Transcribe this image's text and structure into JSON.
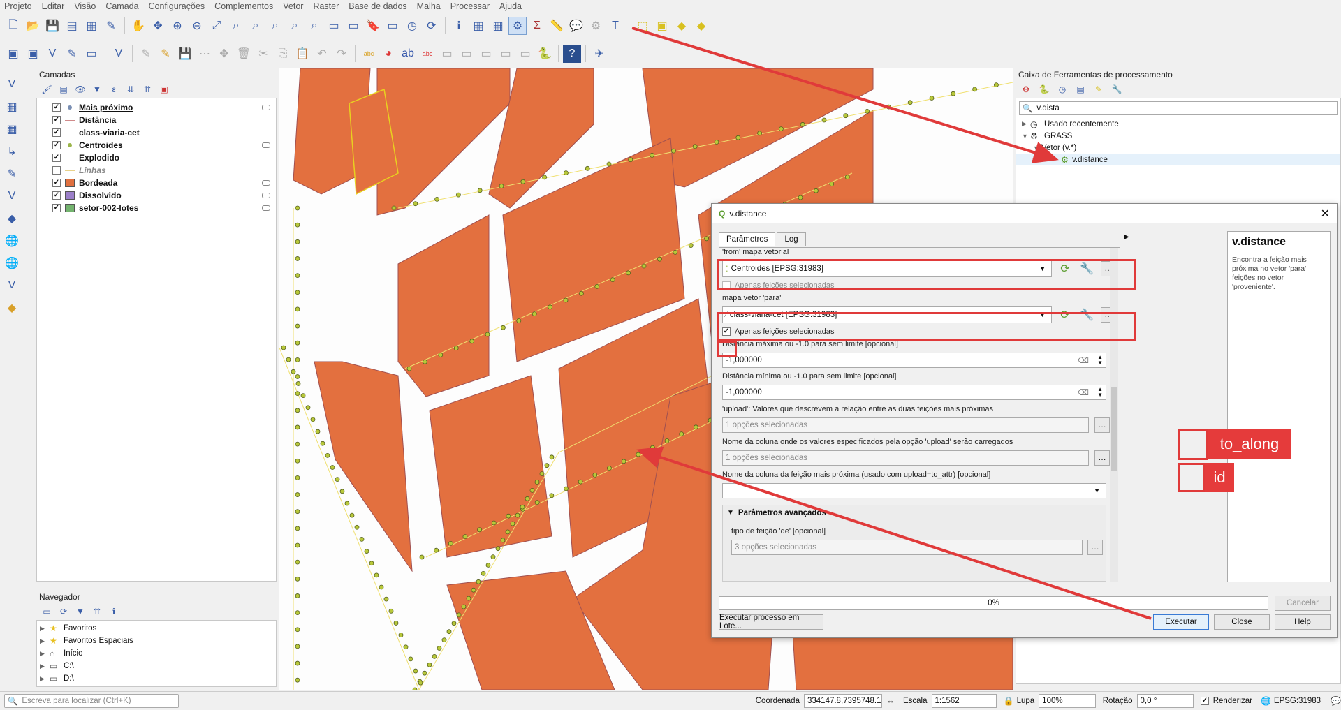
{
  "menu": [
    "Projeto",
    "Editar",
    "Visão",
    "Camada",
    "Configurações",
    "Complementos",
    "Vetor",
    "Raster",
    "Base de dados",
    "Malha",
    "Processar",
    "Ajuda"
  ],
  "layers_panel": {
    "title": "Camadas",
    "layers": [
      {
        "name": "Mais próximo",
        "checked": true,
        "symbol": "point",
        "color": "#7a8fb3",
        "style": "bold-underline"
      },
      {
        "name": "Distância",
        "checked": true,
        "symbol": "line",
        "color": "#d08a8a",
        "style": "bold"
      },
      {
        "name": "class-viaria-cet",
        "checked": true,
        "symbol": "line",
        "color": "#d08a8a",
        "style": "bold"
      },
      {
        "name": "Centroides",
        "checked": true,
        "symbol": "point",
        "color": "#9bb54a",
        "style": "bold"
      },
      {
        "name": "Explodido",
        "checked": true,
        "symbol": "line",
        "color": "#d08a8a",
        "style": "bold"
      },
      {
        "name": "Linhas",
        "checked": false,
        "symbol": "line",
        "color": "#e8d28a",
        "style": "italic"
      },
      {
        "name": "Bordeada",
        "checked": true,
        "symbol": "fill",
        "color": "#e0703f",
        "style": "bold"
      },
      {
        "name": "Dissolvido",
        "checked": true,
        "symbol": "fill",
        "color": "#9b7fc9",
        "style": "bold"
      },
      {
        "name": "setor-002-lotes",
        "checked": true,
        "symbol": "fill",
        "color": "#73b36e",
        "style": "bold"
      }
    ]
  },
  "navigator": {
    "title": "Navegador",
    "items": [
      "Favoritos",
      "Favoritos Espaciais",
      "Início",
      "C:\\",
      "D:\\"
    ]
  },
  "toolbox": {
    "title": "Caixa de Ferramentas de processamento",
    "search": "v.dista",
    "tree": [
      "Usado recentemente",
      "GRASS",
      "Vetor (v.*)",
      "v.distance"
    ]
  },
  "dialog": {
    "title": "v.distance",
    "tabs": [
      "Parâmetros",
      "Log"
    ],
    "from_label": "'from' mapa vetorial",
    "from_value": "Centroides [EPSG:31983]",
    "only_selected": "Apenas feições selecionadas",
    "to_label": "mapa vetor 'para'",
    "to_value": "class-viaria-cet [EPSG:31983]",
    "max_label": "Distância máxima ou -1.0 para sem limite [opcional]",
    "max_value": "-1,000000",
    "min_label": "Distância mínima ou -1.0 para sem limite [opcional]",
    "min_value": "-1,000000",
    "upload_label": "'upload': Valores que descrevem a relação entre as duas feições mais próximas",
    "upload_value": "1 opções selecionadas",
    "column_label": "Nome da coluna onde os valores especificados pela opção 'upload' serão carregados",
    "column_value": "1 opções selecionadas",
    "nearest_col_label": "Nome da coluna da feição mais próxima (usado com upload=to_attr) [opcional]",
    "advanced": "Parâmetros avançados",
    "from_type_label": "tipo de feição 'de' [opcional]",
    "from_type_value": "3 opções selecionadas",
    "progress": "0%",
    "cancel": "Cancelar",
    "batch": "Executar processo em Lote...",
    "run": "Executar",
    "close": "Close",
    "help": "Help",
    "help_title": "v.distance",
    "help_text": "Encontra a feição mais próxima no vetor 'para' feições no vetor 'proveniente'."
  },
  "callouts": {
    "to_along": "to_along",
    "id": "id"
  },
  "status": {
    "search_placeholder": "Escreva para localizar (Ctrl+K)",
    "coord_label": "Coordenada",
    "coord_value": "334147.8,7395748.1",
    "scale_label": "Escala",
    "scale_value": "1:1562",
    "zoom_label": "Lupa",
    "zoom_value": "100%",
    "rotation_label": "Rotação",
    "rotation_value": "0,0 °",
    "render_label": "Renderizar",
    "crs": "EPSG:31983"
  }
}
